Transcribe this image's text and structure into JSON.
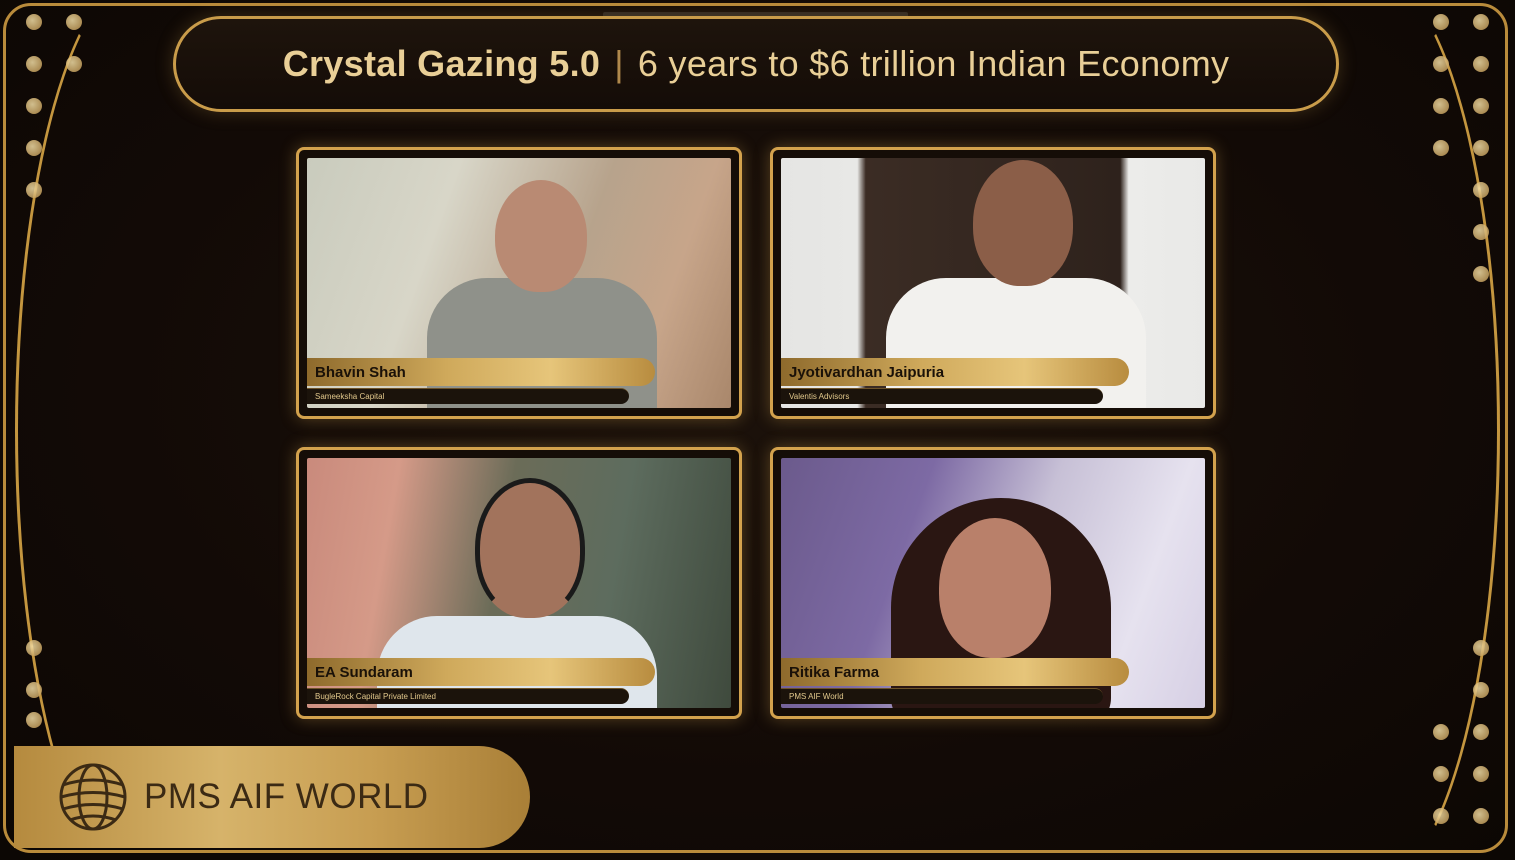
{
  "header": {
    "title_main": "Crystal Gazing 5.0",
    "separator": "|",
    "title_sub": "6 years to $6 trillion Indian Economy"
  },
  "participants": [
    {
      "name": "Bhavin Shah",
      "org": "Sameeksha Capital"
    },
    {
      "name": "Jyotivardhan Jaipuria",
      "org": "Valentis Advisors"
    },
    {
      "name": "EA Sundaram",
      "org": "BugleRock Capital Private Limited"
    },
    {
      "name": "Ritika Farma",
      "org": "PMS AIF World"
    }
  ],
  "branding": {
    "logo_text": "PMS AIF WORLD",
    "icon": "globe-icon"
  },
  "colors": {
    "gold": "#c99c4a",
    "background": "#120a06",
    "title_text": "#e9cf97"
  }
}
